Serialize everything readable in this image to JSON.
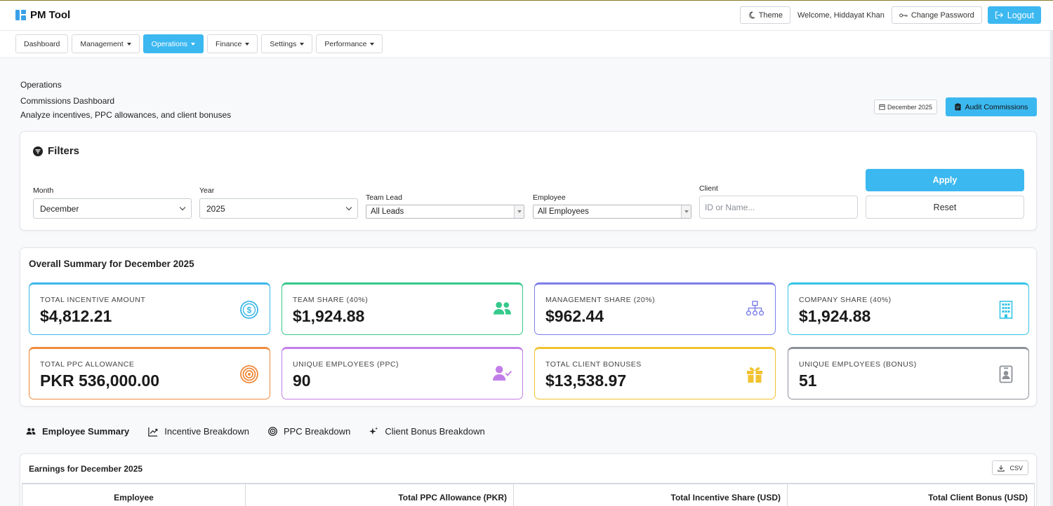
{
  "app": {
    "title": "PM Tool"
  },
  "header": {
    "theme_label": "Theme",
    "welcome": "Welcome, Hiddayat Khan",
    "change_password_label": "Change Password",
    "logout_label": "Logout"
  },
  "nav": {
    "items": [
      {
        "label": "Dashboard",
        "dropdown": false,
        "active": false
      },
      {
        "label": "Management",
        "dropdown": true,
        "active": false
      },
      {
        "label": "Operations",
        "dropdown": true,
        "active": true
      },
      {
        "label": "Finance",
        "dropdown": true,
        "active": false
      },
      {
        "label": "Settings",
        "dropdown": true,
        "active": false
      },
      {
        "label": "Performance",
        "dropdown": true,
        "active": false
      }
    ]
  },
  "page": {
    "breadcrumb": "Operations",
    "title": "Commissions Dashboard",
    "subtitle": "Analyze incentives, PPC allowances, and client bonuses",
    "month_badge": "December 2025",
    "audit_label": "Audit Commissions"
  },
  "filters": {
    "title": "Filters",
    "month": {
      "label": "Month",
      "value": "December"
    },
    "year": {
      "label": "Year",
      "value": "2025"
    },
    "team_lead": {
      "label": "Team Lead",
      "value": "All Leads"
    },
    "employee": {
      "label": "Employee",
      "value": "All Employees"
    },
    "client": {
      "label": "Client",
      "placeholder": "ID or Name..."
    },
    "apply_label": "Apply",
    "reset_label": "Reset"
  },
  "summary": {
    "title": "Overall Summary for December 2025",
    "stats": [
      {
        "label": "TOTAL INCENTIVE AMOUNT",
        "value": "$4,812.21",
        "color": "#3bb6ea",
        "icon": "dollar-circle-icon"
      },
      {
        "label": "TEAM SHARE (40%)",
        "value": "$1,924.88",
        "color": "#34c98a",
        "icon": "users-icon"
      },
      {
        "label": "MANAGEMENT SHARE (20%)",
        "value": "$962.44",
        "color": "#7c7fe8",
        "icon": "sitemap-icon"
      },
      {
        "label": "COMPANY SHARE (40%)",
        "value": "$1,924.88",
        "color": "#35c4e6",
        "icon": "building-icon"
      },
      {
        "label": "TOTAL PPC ALLOWANCE",
        "value": "PKR 536,000.00",
        "color": "#f08a3c",
        "icon": "target-icon"
      },
      {
        "label": "UNIQUE EMPLOYEES (PPC)",
        "value": "90",
        "color": "#c17ee8",
        "icon": "user-check-icon"
      },
      {
        "label": "TOTAL CLIENT BONUSES",
        "value": "$13,538.97",
        "color": "#f2c230",
        "icon": "gift-icon"
      },
      {
        "label": "UNIQUE EMPLOYEES (BONUS)",
        "value": "51",
        "color": "#8d9198",
        "icon": "id-badge-icon"
      }
    ]
  },
  "tabs": [
    {
      "label": "Employee Summary",
      "active": true,
      "icon": "users-icon"
    },
    {
      "label": "Incentive Breakdown",
      "active": false,
      "icon": "chart-line-icon"
    },
    {
      "label": "PPC Breakdown",
      "active": false,
      "icon": "target-icon"
    },
    {
      "label": "Client Bonus Breakdown",
      "active": false,
      "icon": "sparkle-icon"
    }
  ],
  "earnings": {
    "title": "Earnings for December 2025",
    "csv_label": "CSV",
    "columns": [
      "Employee",
      "Total PPC Allowance (PKR)",
      "Total Incentive Share (USD)",
      "Total Client Bonus (USD)"
    ]
  }
}
